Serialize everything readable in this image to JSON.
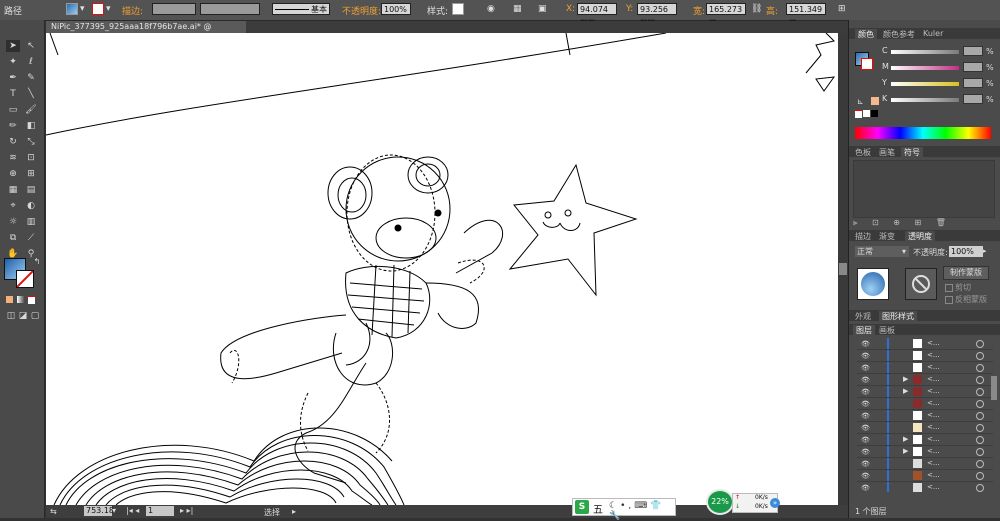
{
  "control_bar": {
    "path_label": "路径",
    "stroke_label": "描边:",
    "stroke_style": "基本",
    "opacity_label": "不透明度:",
    "opacity_value": "100%",
    "style_label": "样式:",
    "x_label": "X:",
    "x_value": "94.074 mm",
    "y_label": "Y:",
    "y_value": "93.256 mm",
    "w_label": "宽:",
    "w_value": "165.273 m",
    "h_label": "高:",
    "h_value": "151.349 m"
  },
  "document": {
    "tab_title": "NiPic_377395_925aaa18f796b7ae.ai* @ 753.18% (RGB/轮廓)",
    "tab_close": "×"
  },
  "color_panel": {
    "tabs": [
      "颜色",
      "颜色参考",
      "Kuler"
    ],
    "channels": [
      {
        "label": "C",
        "value": "",
        "unit": "%"
      },
      {
        "label": "M",
        "value": "",
        "unit": "%"
      },
      {
        "label": "Y",
        "value": "",
        "unit": "%"
      },
      {
        "label": "K",
        "value": "",
        "unit": "%"
      }
    ]
  },
  "swatch_panel": {
    "tabs": [
      "色板",
      "画笔",
      "符号"
    ]
  },
  "transparency_panel": {
    "tabs": [
      "描边",
      "渐变",
      "透明度"
    ],
    "blend_mode": "正常",
    "opacity_label": "不透明度:",
    "opacity_value": "100%",
    "make_mask_button": "制作蒙版",
    "clip_label": "剪切",
    "invert_label": "反相蒙版"
  },
  "appearance_panel": {
    "tabs": [
      "外观",
      "图形样式"
    ]
  },
  "layers_panel": {
    "tabs": [
      "图层",
      "画板"
    ],
    "layer_count": "1 个图层",
    "rows": [
      "<...",
      "<...",
      "<...",
      "<...",
      "<...",
      "<...",
      "<...",
      "<...",
      "<...",
      "<...",
      "<...",
      "<...",
      "<..."
    ]
  },
  "status_bar": {
    "zoom": "753.18",
    "page": "1",
    "tool": "选择"
  },
  "ime_bar": {
    "logo": "S",
    "mode": "五"
  },
  "net_widget": {
    "percent": "22%",
    "up": "0K/s",
    "down": "0K/s"
  },
  "colors": {
    "accent_orange": "#f0a030",
    "layer_stripe": "#2f6fd8",
    "fill_gradient_start": "#2b6db0",
    "stroke_color": "#e01010",
    "net_green": "#1a9a48"
  }
}
